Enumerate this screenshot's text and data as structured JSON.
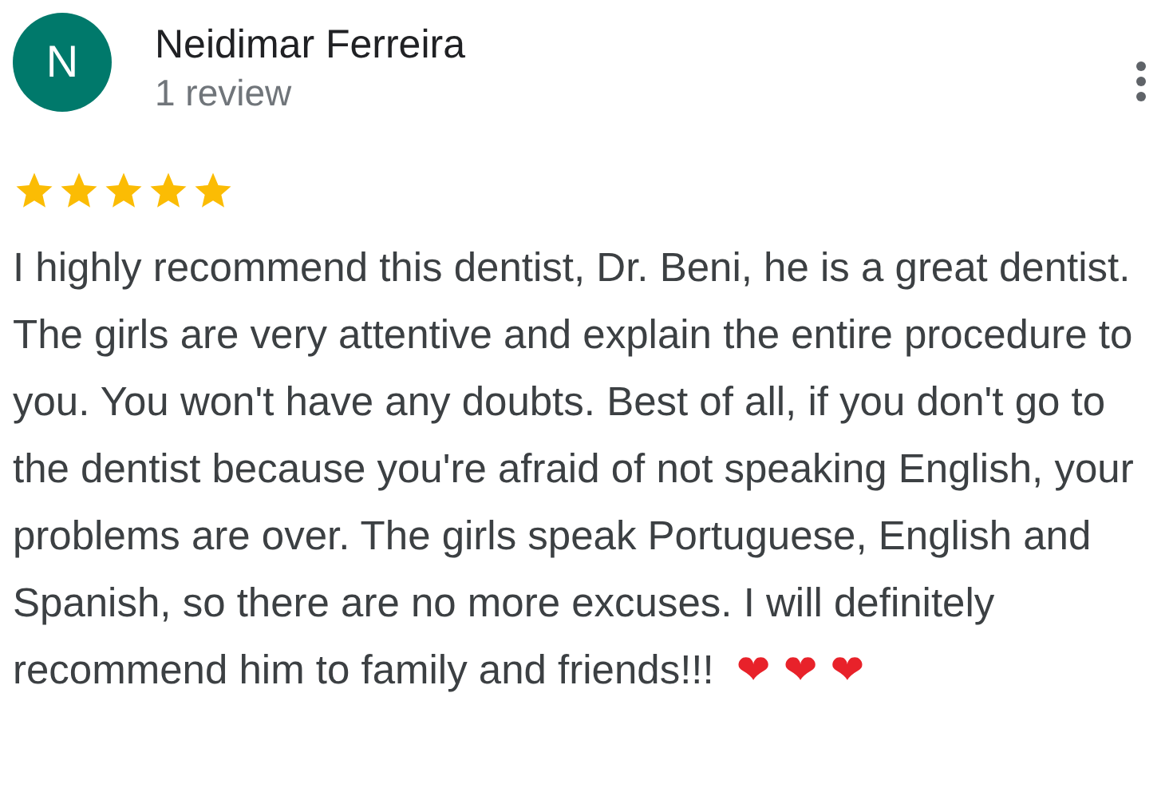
{
  "reviewer": {
    "initial": "N",
    "name": "Neidimar Ferreira",
    "review_count": "1 review"
  },
  "review": {
    "stars": 5,
    "text": "I highly recommend this dentist, Dr. Beni, he is a great dentist. The girls are very attentive and explain the entire procedure to you. You won't have any doubts. Best of all, if you don't go to the dentist because you're afraid of not speaking English, your problems are over. The girls speak Portuguese, English and Spanish, so there are no more excuses. I will definitely recommend him to family and friends!!!",
    "emoji": "❤ ❤ ❤"
  }
}
